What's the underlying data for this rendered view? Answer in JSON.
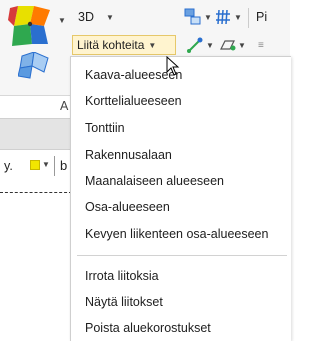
{
  "ribbon": {
    "dropdown_3d_label": "3D",
    "attach_button_label": "Liitä kohteita",
    "right_group_label": "Pi",
    "group_caption": "A"
  },
  "toolbar_row": {
    "partial_label": "y.",
    "partial_letter": "b"
  },
  "menu": {
    "items": [
      "Kaava-alueeseen",
      "Korttelialueeseen",
      "Tonttiin",
      "Rakennusalaan",
      "Maanalaiseen alueeseen",
      "Osa-alueeseen",
      "Kevyen liikenteen osa-alueeseen"
    ],
    "actions": [
      "Irrota liitoksia",
      "Näytä liitokset",
      "Poista aluekorostukset"
    ]
  },
  "colors": {
    "highlight_bg": "#fff4cf",
    "highlight_border": "#e6c86a",
    "accent_blue": "#2a6fcf"
  }
}
